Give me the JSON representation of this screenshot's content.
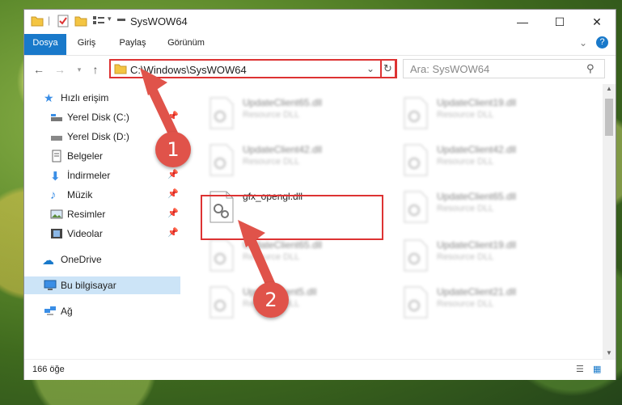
{
  "window": {
    "title": "SysWOW64"
  },
  "ribbon": {
    "tabs": [
      "Dosya",
      "Giriş",
      "Paylaş",
      "Görünüm"
    ]
  },
  "address": {
    "path": "C:\\Windows\\SysWOW64"
  },
  "search": {
    "placeholder": "Ara: SysWOW64"
  },
  "sidebar": {
    "items": [
      {
        "label": "Hızlı erişim",
        "icon": "star-icon"
      },
      {
        "label": "Yerel Disk (C:)",
        "icon": "drive-icon"
      },
      {
        "label": "Yerel Disk (D:)",
        "icon": "drive-icon"
      },
      {
        "label": "Belgeler",
        "icon": "documents-icon"
      },
      {
        "label": "İndirmeler",
        "icon": "download-icon"
      },
      {
        "label": "Müzik",
        "icon": "music-icon"
      },
      {
        "label": "Resimler",
        "icon": "pictures-icon"
      },
      {
        "label": "Videolar",
        "icon": "video-icon"
      },
      {
        "label": "OneDrive",
        "icon": "cloud-icon"
      },
      {
        "label": "Bu bilgisayar",
        "icon": "computer-icon"
      },
      {
        "label": "Ağ",
        "icon": "network-icon"
      }
    ]
  },
  "files": [
    {
      "name": "UpdateClient65.dll",
      "type": "Resource DLL"
    },
    {
      "name": "UpdateClient19.dll",
      "type": "Resource DLL"
    },
    {
      "name": "UpdateClient42.dll",
      "type": "Resource DLL"
    },
    {
      "name": "UpdateClient42.dll",
      "type": "Resource DLL"
    },
    {
      "name": "gfx_opengl.dll",
      "type": ""
    },
    {
      "name": "UpdateClient65.dll",
      "type": "Resource DLL"
    },
    {
      "name": "UpdateClient65.dll",
      "type": "Resource DLL"
    },
    {
      "name": "UpdateClient19.dll",
      "type": "Resource DLL"
    },
    {
      "name": "UpdateClient5.dll",
      "type": "Resource DLL"
    },
    {
      "name": "UpdateClient21.dll",
      "type": "Resource DLL"
    }
  ],
  "status": {
    "count": "166 öğe"
  },
  "annotations": {
    "step1": "1",
    "step2": "2"
  },
  "colors": {
    "accent": "#1979ca",
    "highlight": "#dd3333",
    "badge": "#e0534a"
  }
}
